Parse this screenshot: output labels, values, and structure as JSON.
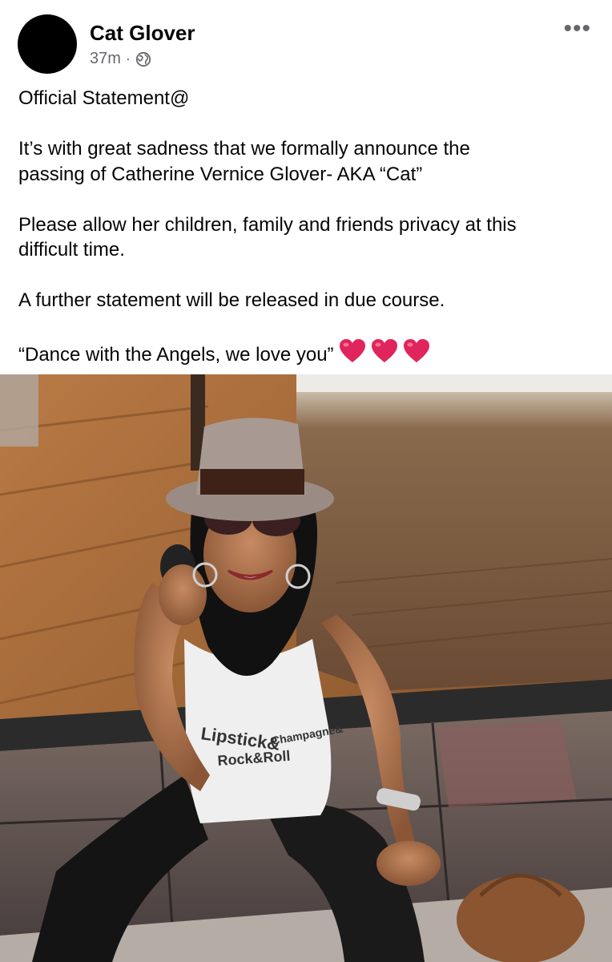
{
  "post": {
    "author": "Cat Glover",
    "time": "37m",
    "separator": "·",
    "visibility_icon": "globe-icon",
    "more_icon": "more-options-icon",
    "more_glyph": "•••"
  },
  "content": {
    "line1": "Official Statement@",
    "line2": "It’s with great sadness that we formally announce the",
    "line3": "passing of  Catherine Vernice Glover- AKA “Cat”",
    "line4": "Please allow her children, family and friends privacy at this",
    "line5": "difficult time.",
    "line6": "A further statement will be released in due course.",
    "line7": "“Dance with the Angels, we love you”",
    "emoji_icon": "red-heart-icon",
    "emoji_count": 3
  },
  "photo": {
    "shirt_line1": "Lipstick&",
    "shirt_line2": "Rock&Roll",
    "shirt_line3": "Champagne&"
  },
  "colors": {
    "text": "#050505",
    "secondary_text": "#65676b",
    "heart": "#e0245e"
  }
}
